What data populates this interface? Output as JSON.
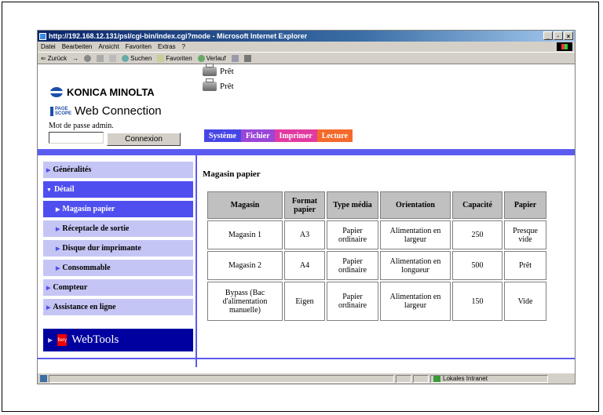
{
  "browser": {
    "title": "http://192.168.12.131/psl/cgi-bin/index.cgi?mode - Microsoft Internet Explorer",
    "window_buttons": [
      "_",
      "·",
      "×"
    ],
    "menu": [
      "Datei",
      "Bearbeiten",
      "Ansicht",
      "Favoriten",
      "Extras",
      "?"
    ],
    "toolbar": {
      "back": "Zurück",
      "forward_arrow": "→",
      "search": "Suchen",
      "favorites": "Favoriten",
      "history": "Verlauf"
    },
    "statusbar": {
      "zone": "Lokales Intranet"
    }
  },
  "header": {
    "brand": "KONICA MINOLTA",
    "pagescope_top": "PAGE",
    "pagescope_bottom": "SCOPE",
    "product": "Web Connection",
    "password_label": "Mot de passe admin.",
    "password_value": "",
    "login_button": "Connexion",
    "status_1": "Prêt",
    "status_2": "Prêt"
  },
  "tabs": [
    {
      "label": "Système",
      "color": "#4646e6"
    },
    {
      "label": "Fichier",
      "color": "#9a46d8"
    },
    {
      "label": "Imprimer",
      "color": "#e23aa0"
    },
    {
      "label": "Lecture",
      "color": "#f46a2a"
    }
  ],
  "nav": {
    "items": [
      "Généralités",
      "Détail",
      "Magasin papier",
      "Réceptacle de sortie",
      "Disque dur imprimante",
      "Consommable",
      "Compteur",
      "Assistance en ligne"
    ],
    "webtools": "WebTools",
    "fiery": "fiery"
  },
  "main": {
    "title": "Magasin papier",
    "columns": [
      "Magasin",
      "Format papier",
      "Type média",
      "Orientation",
      "Capacité",
      "Papier"
    ],
    "rows": [
      [
        "Magasin 1",
        "A3",
        "Papier ordinaire",
        "Alimentation en largeur",
        "250",
        "Presque vide"
      ],
      [
        "Magasin 2",
        "A4",
        "Papier ordinaire",
        "Alimentation en longueur",
        "500",
        "Prêt"
      ],
      [
        "Bypass (Bac d'alimentation manuelle)",
        "Eigen",
        "Papier ordinaire",
        "Alimentation en largeur",
        "150",
        "Vide"
      ]
    ]
  }
}
